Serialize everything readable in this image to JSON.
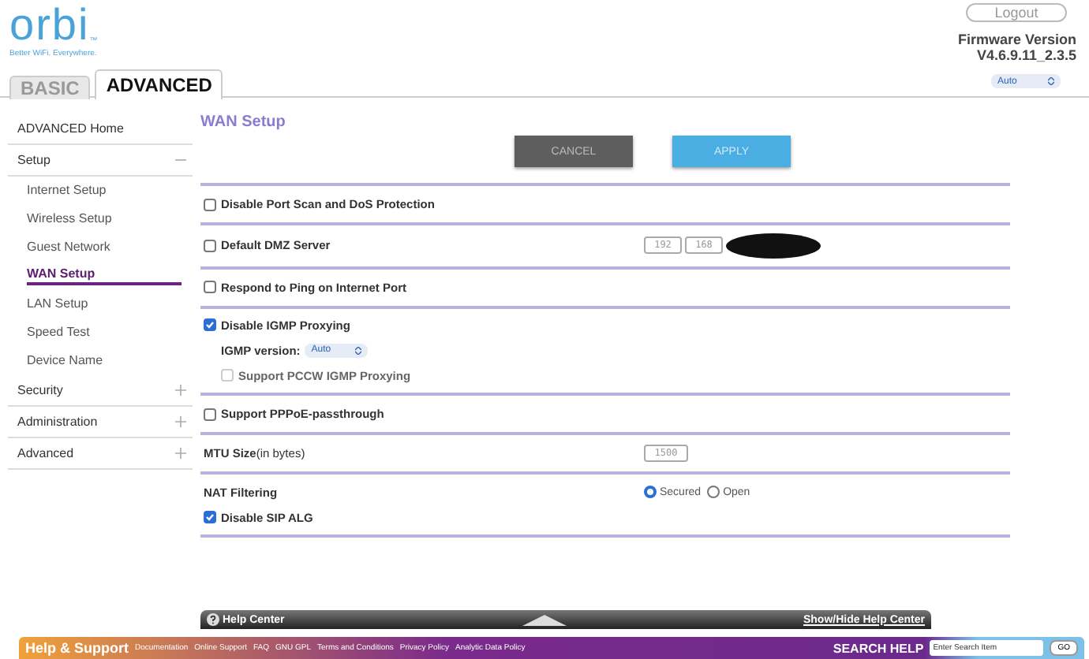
{
  "logo": {
    "wordmark": "orbi",
    "trademark": "™",
    "tagline": "Better WiFi. Everywhere."
  },
  "header": {
    "logout": "Logout",
    "firmware_label": "Firmware Version",
    "firmware_version": "V4.6.9.11_2.3.5",
    "language": "Auto"
  },
  "tabs": [
    {
      "label": "BASIC",
      "selected": false
    },
    {
      "label": "ADVANCED",
      "selected": true
    }
  ],
  "sidebar": {
    "items": [
      {
        "label": "ADVANCED Home",
        "selected": false
      },
      {
        "label": "Setup",
        "expanded": true,
        "selected": false,
        "children": [
          {
            "label": "Internet Setup",
            "selected": false
          },
          {
            "label": "Wireless Setup",
            "selected": false
          },
          {
            "label": "Guest Network",
            "selected": false
          },
          {
            "label": "WAN Setup",
            "selected": true
          },
          {
            "label": "LAN Setup",
            "selected": false
          },
          {
            "label": "Speed Test",
            "selected": false
          },
          {
            "label": "Device Name",
            "selected": false
          }
        ]
      },
      {
        "label": "Security",
        "expanded": false,
        "selected": false
      },
      {
        "label": "Administration",
        "expanded": false,
        "selected": false
      },
      {
        "label": "Advanced",
        "expanded": false,
        "selected": false
      }
    ]
  },
  "content": {
    "title": "WAN Setup",
    "buttons": [
      {
        "label": "CANCEL",
        "kind": "cancel"
      },
      {
        "label": "APPLY",
        "kind": "apply"
      }
    ],
    "sections": [
      {
        "kind": "checkbox",
        "label": "Disable Port Scan and DoS Protection",
        "checked": false
      },
      {
        "kind": "dmz",
        "label": "Default DMZ Server",
        "checked": false,
        "ip": [
          "192",
          "168"
        ],
        "redacted": true
      },
      {
        "kind": "checkbox",
        "label": "Respond to Ping on Internet Port",
        "checked": false
      },
      {
        "kind": "igmp",
        "label": "Disable IGMP Proxying",
        "checked": true,
        "version_label": "IGMP version:",
        "version": "Auto",
        "sub_label": "Support PCCW IGMP Proxying",
        "sub_checked": false,
        "sub_disabled": true
      },
      {
        "kind": "checkbox",
        "label": "Support PPPoE-passthrough",
        "checked": false
      },
      {
        "kind": "mtu",
        "label": "**MTU Size**(in bytes)",
        "value": "1500"
      },
      {
        "kind": "nat",
        "label": "NAT Filtering",
        "options": [
          {
            "label": "Secured",
            "selected": true
          },
          {
            "label": "Open",
            "selected": false
          }
        ],
        "sip_label": "Disable SIP ALG",
        "sip_checked": true
      }
    ]
  },
  "help_center": {
    "label": "Help Center",
    "toggle": "Show/Hide Help Center"
  },
  "footer": {
    "title": "Help & Support",
    "links": [
      "Documentation",
      "Online Support",
      "FAQ",
      "GNU GPL",
      "Terms and Conditions",
      "Privacy Policy",
      "Analytic Data Policy"
    ],
    "search_label": "SEARCH HELP",
    "search_placeholder": "Enter Search Item",
    "go": "GO"
  }
}
